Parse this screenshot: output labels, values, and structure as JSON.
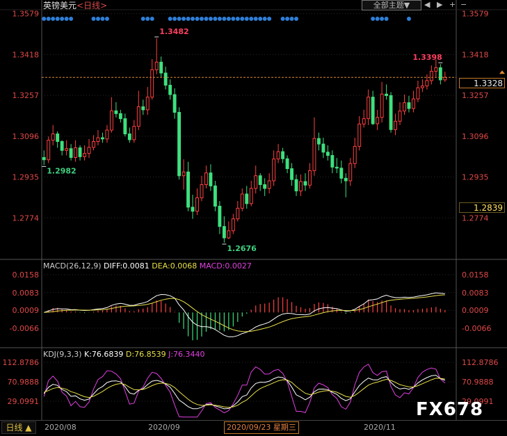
{
  "header": {
    "instrument": "英镑美元",
    "period_tag": "<日线>",
    "theme_button": "全部主题▼",
    "nav_prev": "◀",
    "nav_next": "▶",
    "zoom_in": "+",
    "zoom_out": "−"
  },
  "price_panel": {
    "axis_ticks": [
      "1.3579",
      "1.3418",
      "1.3257",
      "1.3096",
      "1.2935",
      "1.2774"
    ],
    "current_price_label": "1.3328",
    "cursor_price_label": "1.2839",
    "annotations": [
      {
        "text": "1.3482",
        "color": "#ff4060"
      },
      {
        "text": "1.3398",
        "color": "#ff4060"
      },
      {
        "text": "1.2982",
        "color": "#40d080"
      },
      {
        "text": "1.2676",
        "color": "#40d080"
      }
    ]
  },
  "macd_panel": {
    "label": "MACD(26,12,9)",
    "diff_label": "DIFF:0.0081",
    "dea_label": "DEA:0.0068",
    "macd_label": "MACD:0.0027",
    "axis_ticks": [
      "0.0158",
      "0.0083",
      "0.0009",
      "-0.0066"
    ]
  },
  "kdj_panel": {
    "label": "KDJ(9,3,3)",
    "k_label": "K:76.6839",
    "d_label": "D:76.8539",
    "j_label": "J:76.3440",
    "axis_ticks": [
      "112.8786",
      "70.9888",
      "29.0991"
    ]
  },
  "footer": {
    "period_button": "日线 ▲",
    "date_labels": [
      "2020/08",
      "2020/09",
      "2020/11"
    ],
    "cursor_date": "2020/09/23 星期三",
    "watermark": "FX678"
  },
  "colors": {
    "up": "#ff4040",
    "down": "#3ee07e",
    "axis_text": "#e04848",
    "grid": "#2a2a2a",
    "diff_line": "#ffffff",
    "dea_line": "#e8e04a",
    "k_line": "#ffffff",
    "d_line": "#e8e04a",
    "j_line": "#e040e0",
    "price_line": "#e08a30"
  },
  "chart_data": [
    {
      "type": "candlestick",
      "series_name": "英镑美元 日线",
      "x": [
        "2020/07/28",
        "2020/07/29",
        "2020/07/30",
        "2020/07/31",
        "2020/08/03",
        "2020/08/04",
        "2020/08/05",
        "2020/08/06",
        "2020/08/07",
        "2020/08/10",
        "2020/08/11",
        "2020/08/12",
        "2020/08/13",
        "2020/08/14",
        "2020/08/17",
        "2020/08/18",
        "2020/08/19",
        "2020/08/20",
        "2020/08/21",
        "2020/08/24",
        "2020/08/25",
        "2020/08/26",
        "2020/08/27",
        "2020/08/28",
        "2020/08/31",
        "2020/09/01",
        "2020/09/02",
        "2020/09/03",
        "2020/09/04",
        "2020/09/07",
        "2020/09/08",
        "2020/09/09",
        "2020/09/10",
        "2020/09/11",
        "2020/09/14",
        "2020/09/15",
        "2020/09/16",
        "2020/09/17",
        "2020/09/18",
        "2020/09/21",
        "2020/09/22",
        "2020/09/23",
        "2020/09/24",
        "2020/09/25",
        "2020/09/28",
        "2020/09/29",
        "2020/09/30",
        "2020/10/01",
        "2020/10/02",
        "2020/10/05",
        "2020/10/06",
        "2020/10/07",
        "2020/10/08",
        "2020/10/09",
        "2020/10/12",
        "2020/10/13",
        "2020/10/14",
        "2020/10/15",
        "2020/10/16",
        "2020/10/19",
        "2020/10/20",
        "2020/10/21",
        "2020/10/22",
        "2020/10/23",
        "2020/10/26",
        "2020/10/27",
        "2020/10/28",
        "2020/10/29",
        "2020/10/30",
        "2020/11/02",
        "2020/11/03",
        "2020/11/04",
        "2020/11/05",
        "2020/11/06",
        "2020/11/09",
        "2020/11/10",
        "2020/11/11",
        "2020/11/12",
        "2020/11/13",
        "2020/11/16",
        "2020/11/17",
        "2020/11/18",
        "2020/11/19",
        "2020/11/20",
        "2020/11/23",
        "2020/11/24",
        "2020/11/25",
        "2020/11/26",
        "2020/11/27",
        "2020/11/30",
        "2020/12/01",
        "2020/12/02"
      ],
      "open": [
        1.3012,
        1.3003,
        1.308,
        1.3105,
        1.3075,
        1.304,
        1.3047,
        1.3012,
        1.305,
        1.3015,
        1.3028,
        1.3052,
        1.3075,
        1.309,
        1.3085,
        1.312,
        1.3196,
        1.3185,
        1.3165,
        1.3105,
        1.3082,
        1.3135,
        1.3212,
        1.32,
        1.325,
        1.3358,
        1.3388,
        1.3345,
        1.3297,
        1.326,
        1.319,
        1.294,
        1.2955,
        1.2816,
        1.28,
        1.2853,
        1.2905,
        1.2951,
        1.29,
        1.282,
        1.274,
        1.2695,
        1.2723,
        1.277,
        1.2812,
        1.2868,
        1.283,
        1.289,
        1.294,
        1.2905,
        1.289,
        1.292,
        1.3006,
        1.3035,
        1.3007,
        1.2968,
        1.2925,
        1.288,
        1.2917,
        1.2903,
        1.296,
        1.3087,
        1.3065,
        1.3033,
        1.302,
        1.2974,
        1.297,
        1.293,
        1.292,
        1.2988,
        1.3056,
        1.3144,
        1.3165,
        1.325,
        1.3145,
        1.317,
        1.3262,
        1.3256,
        1.3122,
        1.3155,
        1.3195,
        1.3228,
        1.3205,
        1.3243,
        1.3287,
        1.3294,
        1.3315,
        1.3352,
        1.3366,
        1.3318
      ],
      "close": [
        1.3003,
        1.308,
        1.3105,
        1.3075,
        1.304,
        1.3047,
        1.3012,
        1.305,
        1.3015,
        1.3028,
        1.3052,
        1.3075,
        1.309,
        1.3085,
        1.312,
        1.3196,
        1.3185,
        1.3165,
        1.3105,
        1.3082,
        1.3135,
        1.3212,
        1.32,
        1.325,
        1.3358,
        1.3388,
        1.3345,
        1.3297,
        1.326,
        1.319,
        1.294,
        1.2955,
        1.2816,
        1.28,
        1.2853,
        1.2905,
        1.2951,
        1.29,
        1.282,
        1.274,
        1.2695,
        1.2723,
        1.277,
        1.2812,
        1.2868,
        1.283,
        1.289,
        1.294,
        1.2905,
        1.289,
        1.292,
        1.3006,
        1.3035,
        1.3007,
        1.2968,
        1.2925,
        1.288,
        1.2917,
        1.2903,
        1.296,
        1.3087,
        1.3065,
        1.3033,
        1.302,
        1.2974,
        1.297,
        1.293,
        1.292,
        1.2988,
        1.3056,
        1.3144,
        1.3165,
        1.325,
        1.3145,
        1.317,
        1.3262,
        1.3256,
        1.3122,
        1.3155,
        1.3195,
        1.3228,
        1.3205,
        1.3243,
        1.3287,
        1.3294,
        1.3315,
        1.3352,
        1.3366,
        1.3318,
        1.3328
      ],
      "high": [
        1.304,
        1.3095,
        1.314,
        1.3115,
        1.308,
        1.308,
        1.3065,
        1.308,
        1.306,
        1.306,
        1.3085,
        1.31,
        1.312,
        1.311,
        1.314,
        1.325,
        1.323,
        1.32,
        1.3185,
        1.313,
        1.316,
        1.3275,
        1.324,
        1.329,
        1.34,
        1.3482,
        1.341,
        1.337,
        1.332,
        1.3285,
        1.321,
        1.3005,
        1.2995,
        1.2865,
        1.289,
        1.294,
        1.298,
        1.2985,
        1.292,
        1.284,
        1.278,
        1.276,
        1.279,
        1.284,
        1.289,
        1.29,
        1.292,
        1.298,
        1.295,
        1.293,
        1.295,
        1.304,
        1.3065,
        1.305,
        1.302,
        1.299,
        1.2945,
        1.2945,
        1.295,
        1.299,
        1.317,
        1.311,
        1.309,
        1.306,
        1.304,
        1.301,
        1.3,
        1.295,
        1.301,
        1.309,
        1.3175,
        1.32,
        1.328,
        1.3275,
        1.32,
        1.331,
        1.33,
        1.327,
        1.3185,
        1.323,
        1.326,
        1.3255,
        1.3275,
        1.3315,
        1.332,
        1.334,
        1.3375,
        1.3398,
        1.338,
        1.335
      ],
      "low": [
        1.2982,
        1.299,
        1.306,
        1.305,
        1.302,
        1.302,
        1.3,
        1.2995,
        1.3,
        1.3,
        1.301,
        1.304,
        1.306,
        1.307,
        1.307,
        1.311,
        1.317,
        1.315,
        1.3095,
        1.307,
        1.307,
        1.312,
        1.318,
        1.318,
        1.324,
        1.334,
        1.333,
        1.328,
        1.324,
        1.3165,
        1.2925,
        1.2885,
        1.28,
        1.277,
        1.2785,
        1.284,
        1.289,
        1.288,
        1.28,
        1.271,
        1.2676,
        1.269,
        1.271,
        1.276,
        1.28,
        1.281,
        1.282,
        1.287,
        1.288,
        1.286,
        1.287,
        1.29,
        1.299,
        1.299,
        1.295,
        1.29,
        1.286,
        1.286,
        1.288,
        1.289,
        1.294,
        1.304,
        1.301,
        1.3,
        1.295,
        1.295,
        1.291,
        1.2855,
        1.29,
        1.297,
        1.304,
        1.313,
        1.314,
        1.314,
        1.312,
        1.315,
        1.324,
        1.311,
        1.31,
        1.314,
        1.318,
        1.319,
        1.319,
        1.323,
        1.327,
        1.328,
        1.33,
        1.333,
        1.33,
        1.331
      ],
      "y_axis_ticks": [
        1.3579,
        1.3418,
        1.3257,
        1.3096,
        1.2935,
        1.2774
      ],
      "ylim": [
        1.2613,
        1.36
      ],
      "highlighted_points": [
        {
          "label": "1.3482",
          "x": "2020/09/01"
        },
        {
          "label": "1.3398",
          "x": "2020/11/27"
        },
        {
          "label": "1.2982",
          "x": "2020/07/28"
        },
        {
          "label": "1.2676",
          "x": "2020/09/22"
        }
      ],
      "last_price": 1.3328,
      "cursor_price": 1.2839,
      "cursor_date": "2020/09/23",
      "event_markers_dots": true
    },
    {
      "type": "line+bar",
      "name": "MACD(26,12,9)",
      "series": [
        {
          "name": "DIFF",
          "last": 0.0081
        },
        {
          "name": "DEA",
          "last": 0.0068
        },
        {
          "name": "MACD",
          "last": 0.0027
        }
      ],
      "y_axis_ticks": [
        0.0158,
        0.0083,
        0.0009,
        -0.0066
      ]
    },
    {
      "type": "line",
      "name": "KDJ(9,3,3)",
      "series": [
        {
          "name": "K",
          "last": 76.6839
        },
        {
          "name": "D",
          "last": 76.8539
        },
        {
          "name": "J",
          "last": 76.344
        }
      ],
      "y_axis_ticks": [
        112.8786,
        70.9888,
        29.0991
      ]
    }
  ]
}
